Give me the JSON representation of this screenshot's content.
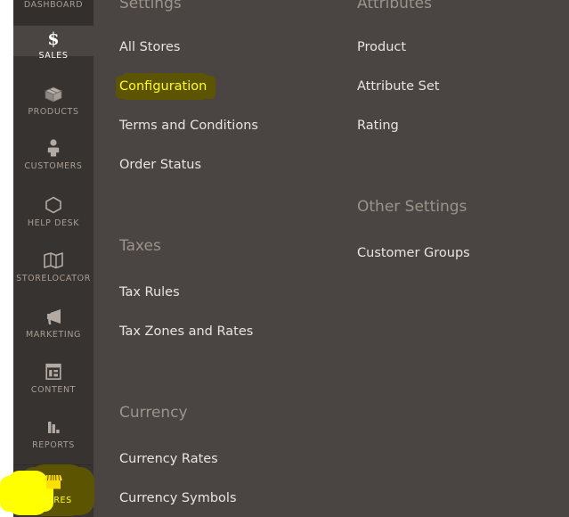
{
  "app": {
    "theme": {
      "rail_bg": "#373330",
      "rail_active_bg": "#4a4542",
      "panel_bg": "#4a4542",
      "label_color": "#a79d95",
      "link_color": "#e8e4e0",
      "heading_color": "#9b938c",
      "highlight_yellow": "#ffff00",
      "highlight_olive": "#5c5400",
      "highlight_text": "#ffff1a"
    }
  },
  "sidebar": {
    "items": [
      {
        "label": "DASHBOARD",
        "icon": "dashboard-icon",
        "state": "partial"
      },
      {
        "label": "SALES",
        "icon": "dollar-icon",
        "state": "active"
      },
      {
        "label": "PRODUCTS",
        "icon": "box-icon",
        "state": "normal"
      },
      {
        "label": "CUSTOMERS",
        "icon": "person-icon",
        "state": "normal"
      },
      {
        "label": "HELP DESK",
        "icon": "hexagon-icon",
        "state": "normal"
      },
      {
        "label": "STORELOCATOR",
        "icon": "map-icon",
        "state": "normal"
      },
      {
        "label": "MARKETING",
        "icon": "megaphone-icon",
        "state": "normal"
      },
      {
        "label": "CONTENT",
        "icon": "layout-icon",
        "state": "normal"
      },
      {
        "label": "REPORTS",
        "icon": "bar-chart-icon",
        "state": "normal"
      },
      {
        "label": "STORES",
        "icon": "storefront-icon",
        "state": "active-highlighted"
      }
    ]
  },
  "menu": {
    "columns": [
      {
        "name": "settings-column",
        "groups": [
          {
            "heading": "Settings",
            "links": [
              {
                "label": "All Stores",
                "highlighted": false
              },
              {
                "label": "Configuration",
                "highlighted": true
              },
              {
                "label": "Terms and Conditions",
                "highlighted": false
              },
              {
                "label": "Order Status",
                "highlighted": false
              }
            ]
          },
          {
            "heading": "Taxes",
            "links": [
              {
                "label": "Tax Rules",
                "highlighted": false
              },
              {
                "label": "Tax Zones and Rates",
                "highlighted": false
              }
            ]
          },
          {
            "heading": "Currency",
            "links": [
              {
                "label": "Currency Rates",
                "highlighted": false
              },
              {
                "label": "Currency Symbols",
                "highlighted": false
              }
            ]
          }
        ]
      },
      {
        "name": "attributes-column",
        "groups": [
          {
            "heading": "Attributes",
            "links": [
              {
                "label": "Product",
                "highlighted": false
              },
              {
                "label": "Attribute Set",
                "highlighted": false
              },
              {
                "label": "Rating",
                "highlighted": false
              }
            ]
          },
          {
            "heading": "Other Settings",
            "links": [
              {
                "label": "Customer Groups",
                "highlighted": false
              }
            ]
          }
        ]
      }
    ]
  }
}
